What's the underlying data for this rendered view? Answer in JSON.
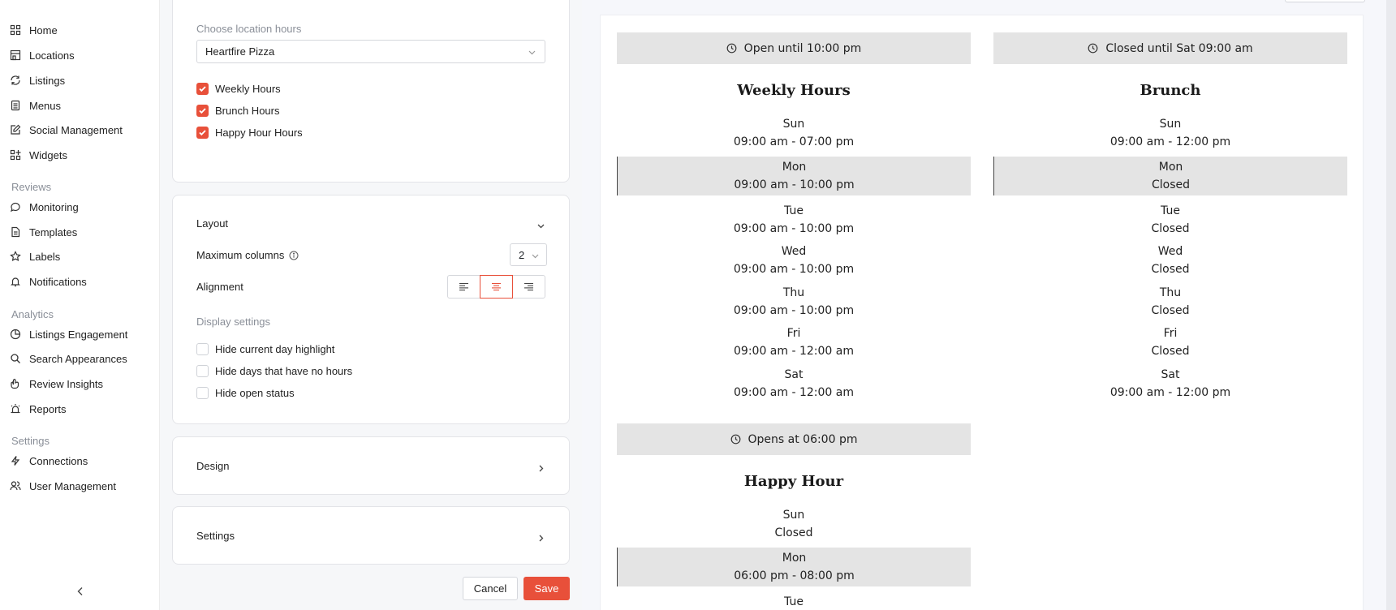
{
  "sidebar": {
    "main_items": [
      {
        "label": "Home",
        "icon": "grid-icon"
      },
      {
        "label": "Locations",
        "icon": "store-icon"
      },
      {
        "label": "Listings",
        "icon": "sync-icon"
      },
      {
        "label": "Menus",
        "icon": "menu-doc-icon"
      },
      {
        "label": "Social Management",
        "icon": "edit-icon"
      },
      {
        "label": "Widgets",
        "icon": "widgets-icon"
      }
    ],
    "reviews_title": "Reviews",
    "reviews_items": [
      {
        "label": "Monitoring",
        "icon": "chat-icon"
      },
      {
        "label": "Templates",
        "icon": "document-icon"
      },
      {
        "label": "Labels",
        "icon": "star-icon"
      },
      {
        "label": "Notifications",
        "icon": "bell-icon"
      }
    ],
    "analytics_title": "Analytics",
    "analytics_items": [
      {
        "label": "Listings Engagement",
        "icon": "pie-chart-icon"
      },
      {
        "label": "Search Appearances",
        "icon": "search-icon"
      },
      {
        "label": "Review Insights",
        "icon": "hand-icon"
      },
      {
        "label": "Reports",
        "icon": "alarm-icon"
      }
    ],
    "settings_title": "Settings",
    "settings_items": [
      {
        "label": "Connections",
        "icon": "bolt-icon"
      },
      {
        "label": "User Management",
        "icon": "users-icon"
      }
    ]
  },
  "hours_card": {
    "label": "Choose location hours",
    "location": "Heartfire Pizza",
    "checkboxes": [
      {
        "label": "Weekly Hours",
        "checked": true
      },
      {
        "label": "Brunch Hours",
        "checked": true
      },
      {
        "label": "Happy Hour Hours",
        "checked": true
      }
    ]
  },
  "layout_card": {
    "title": "Layout",
    "max_columns_label": "Maximum columns",
    "max_columns_value": "2",
    "alignment_label": "Alignment",
    "alignment_selected": "center",
    "display_settings_label": "Display settings",
    "options": [
      {
        "label": "Hide current day highlight",
        "checked": false
      },
      {
        "label": "Hide days that have no hours",
        "checked": false
      },
      {
        "label": "Hide open status",
        "checked": false
      }
    ]
  },
  "design_card": {
    "title": "Design"
  },
  "settings_card": {
    "title": "Settings"
  },
  "actions": {
    "cancel": "Cancel",
    "save": "Save"
  },
  "colors": {
    "accent": "#e8503a",
    "highlight": "#e4e4e4"
  },
  "preview": {
    "schedules": [
      {
        "status": "Open until 10:00 pm",
        "title": "Weekly Hours",
        "days": [
          {
            "day": "Sun",
            "hours": "09:00 am - 07:00 pm",
            "highlight": false
          },
          {
            "day": "Mon",
            "hours": "09:00 am - 10:00 pm",
            "highlight": true
          },
          {
            "day": "Tue",
            "hours": "09:00 am - 10:00 pm",
            "highlight": false
          },
          {
            "day": "Wed",
            "hours": "09:00 am - 10:00 pm",
            "highlight": false
          },
          {
            "day": "Thu",
            "hours": "09:00 am - 10:00 pm",
            "highlight": false
          },
          {
            "day": "Fri",
            "hours": "09:00 am - 12:00 am",
            "highlight": false
          },
          {
            "day": "Sat",
            "hours": "09:00 am - 12:00 am",
            "highlight": false
          }
        ]
      },
      {
        "status": "Closed until Sat 09:00 am",
        "title": "Brunch",
        "days": [
          {
            "day": "Sun",
            "hours": "09:00 am - 12:00 pm",
            "highlight": false
          },
          {
            "day": "Mon",
            "hours": "Closed",
            "highlight": true
          },
          {
            "day": "Tue",
            "hours": "Closed",
            "highlight": false
          },
          {
            "day": "Wed",
            "hours": "Closed",
            "highlight": false
          },
          {
            "day": "Thu",
            "hours": "Closed",
            "highlight": false
          },
          {
            "day": "Fri",
            "hours": "Closed",
            "highlight": false
          },
          {
            "day": "Sat",
            "hours": "09:00 am - 12:00 pm",
            "highlight": false
          }
        ]
      },
      {
        "status": "Opens at 06:00 pm",
        "title": "Happy Hour",
        "days": [
          {
            "day": "Sun",
            "hours": "Closed",
            "highlight": false
          },
          {
            "day": "Mon",
            "hours": "06:00 pm - 08:00 pm",
            "highlight": true
          },
          {
            "day": "Tue",
            "hours": "",
            "highlight": false
          }
        ]
      }
    ]
  }
}
